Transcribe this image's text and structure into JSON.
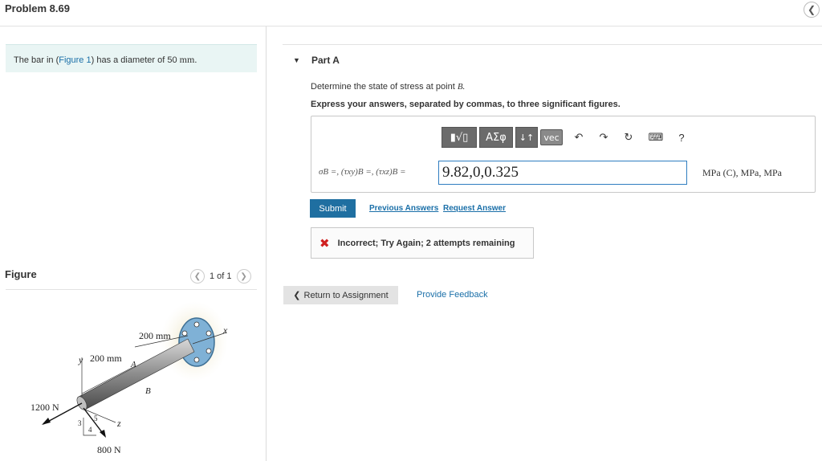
{
  "header": {
    "title": "Problem 8.69"
  },
  "icons": {
    "collapse": "chevron-left-icon",
    "prev": "chevron-left-icon",
    "next": "chevron-right-icon",
    "part_toggle": "triangle-down-icon",
    "undo": "undo-icon",
    "redo": "redo-icon",
    "reset": "reset-icon",
    "keyboard": "keyboard-icon",
    "incorrect": "x-icon"
  },
  "intro": {
    "prefix": "The bar in (",
    "link": "Figure 1",
    "suffix": ") has a diameter of 50 ",
    "unit": "mm."
  },
  "figure": {
    "label": "Figure",
    "pager": "1 of 1",
    "labels": {
      "dim_top": "200 mm",
      "dim_left": "200 mm",
      "axis_x": "x",
      "axis_y": "y",
      "axis_z": "z",
      "point_a": "A",
      "point_b": "B",
      "force_1": "1200 N",
      "force_2": "800 N",
      "ratio_3": "3",
      "ratio_4": "4",
      "ratio_5": "5"
    }
  },
  "part": {
    "title": "Part A",
    "question_prefix": "Determine the state of stress at point ",
    "question_point": "B.",
    "instruction": "Express your answers, separated by commas, to three significant figures.",
    "toolbar": {
      "frac": "▮√▯",
      "greek": "ΑΣφ",
      "arrows": "↓↑",
      "vec": "vec",
      "undo": "↶",
      "redo": "↷",
      "reset": "↻",
      "keyboard": "⌨",
      "help": "?"
    },
    "formula": "σB =, (τxy)B =, (τxz)B =",
    "answer_value": "9.82,0,0.325",
    "units": "MPa (C), MPa, MPa",
    "submit": "Submit",
    "previous_answers": "Previous Answers",
    "request_answer": "Request Answer",
    "feedback_icon": "✖",
    "feedback": "Incorrect; Try Again; 2 attempts remaining"
  },
  "footer": {
    "return": "Return to Assignment",
    "return_glyph": "❮",
    "provide_feedback": "Provide Feedback"
  },
  "colors": {
    "accent": "#1f6fa1",
    "link": "#1a6fa8",
    "intro_bg": "#e9f5f4",
    "error": "#d02020"
  }
}
